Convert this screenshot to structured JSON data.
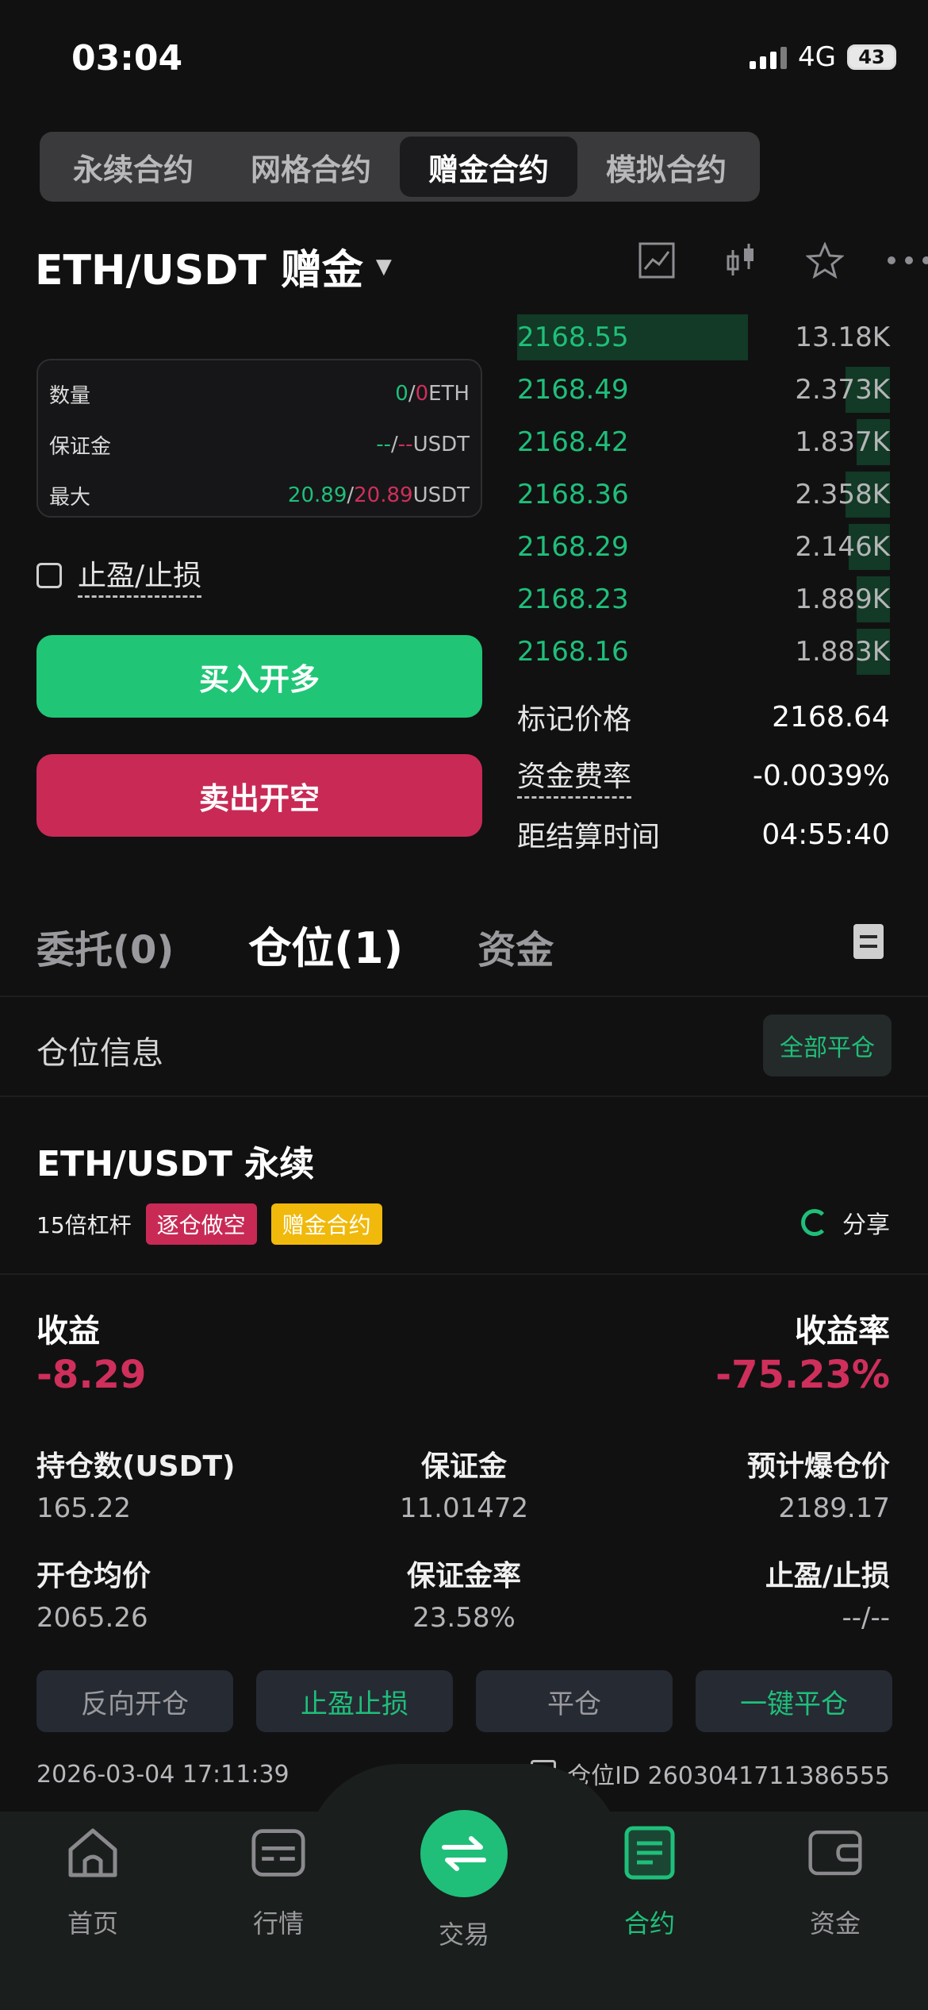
{
  "status": {
    "time": "03:04",
    "network": "4G",
    "battery": "43"
  },
  "contract_tabs": [
    "永续合约",
    "网格合约",
    "赠金合约",
    "模拟合约"
  ],
  "symbol": {
    "name": "ETH/USDT 赠金"
  },
  "info": {
    "rows": [
      {
        "label": "数量",
        "v1": "0",
        "sep": "/",
        "v2": "0",
        "unit": "ETH"
      },
      {
        "label": "保证金",
        "v1": "--",
        "sep": "/",
        "v2": "--",
        "unit": "USDT"
      },
      {
        "label": "最大",
        "v1": "20.89",
        "sep": "/",
        "v2": "20.89",
        "unit": "USDT"
      }
    ]
  },
  "tpsl_label": "止盈/止损",
  "buy_label": "买入开多",
  "sell_label": "卖出开空",
  "orderbook": [
    {
      "price": "2168.55",
      "qty": "13.18K",
      "depth": 0.62
    },
    {
      "price": "2168.49",
      "qty": "2.373K",
      "depth": 0.12
    },
    {
      "price": "2168.42",
      "qty": "1.837K",
      "depth": 0.09
    },
    {
      "price": "2168.36",
      "qty": "2.358K",
      "depth": 0.12
    },
    {
      "price": "2168.29",
      "qty": "2.146K",
      "depth": 0.11
    },
    {
      "price": "2168.23",
      "qty": "1.889K",
      "depth": 0.09
    },
    {
      "price": "2168.16",
      "qty": "1.883K",
      "depth": 0.09
    }
  ],
  "market": {
    "mark_label": "标记价格",
    "mark_value": "2168.64",
    "funding_label": "资金费率",
    "funding_value": "-0.0039%",
    "settle_label": "距结算时间",
    "settle_value": "04:55:40"
  },
  "pos_tabs": [
    "委托(0)",
    "仓位(1)",
    "资金"
  ],
  "position_info_title": "仓位信息",
  "close_all_label": "全部平仓",
  "position": {
    "symbol": "ETH/USDT 永续",
    "leverage": "15倍杠杆",
    "tag_mode": "逐仓做空",
    "tag_type": "赠金合约",
    "share": "分享",
    "pnl_label": "收益",
    "pnl_value": "-8.29",
    "roi_label": "收益率",
    "roi_value": "-75.23%",
    "stats": [
      {
        "label": "持仓数(USDT)",
        "value": "165.22"
      },
      {
        "label": "保证金",
        "value": "11.01472"
      },
      {
        "label": "预计爆仓价",
        "value": "2189.17"
      },
      {
        "label": "开仓均价",
        "value": "2065.26"
      },
      {
        "label": "保证金率",
        "value": "23.58%"
      },
      {
        "label": "止盈/止损",
        "value": "--/--"
      }
    ],
    "actions": [
      "反向开仓",
      "止盈止损",
      "平仓",
      "一键平仓"
    ],
    "timestamp": "2026-03-04 17:11:39",
    "position_id": "仓位ID 2603041711386555"
  },
  "nav": [
    "首页",
    "行情",
    "交易",
    "合约",
    "资金"
  ],
  "colors": {
    "green": "#1fbf7a",
    "red": "#cf2f5b",
    "yellow": "#f0b90b"
  }
}
